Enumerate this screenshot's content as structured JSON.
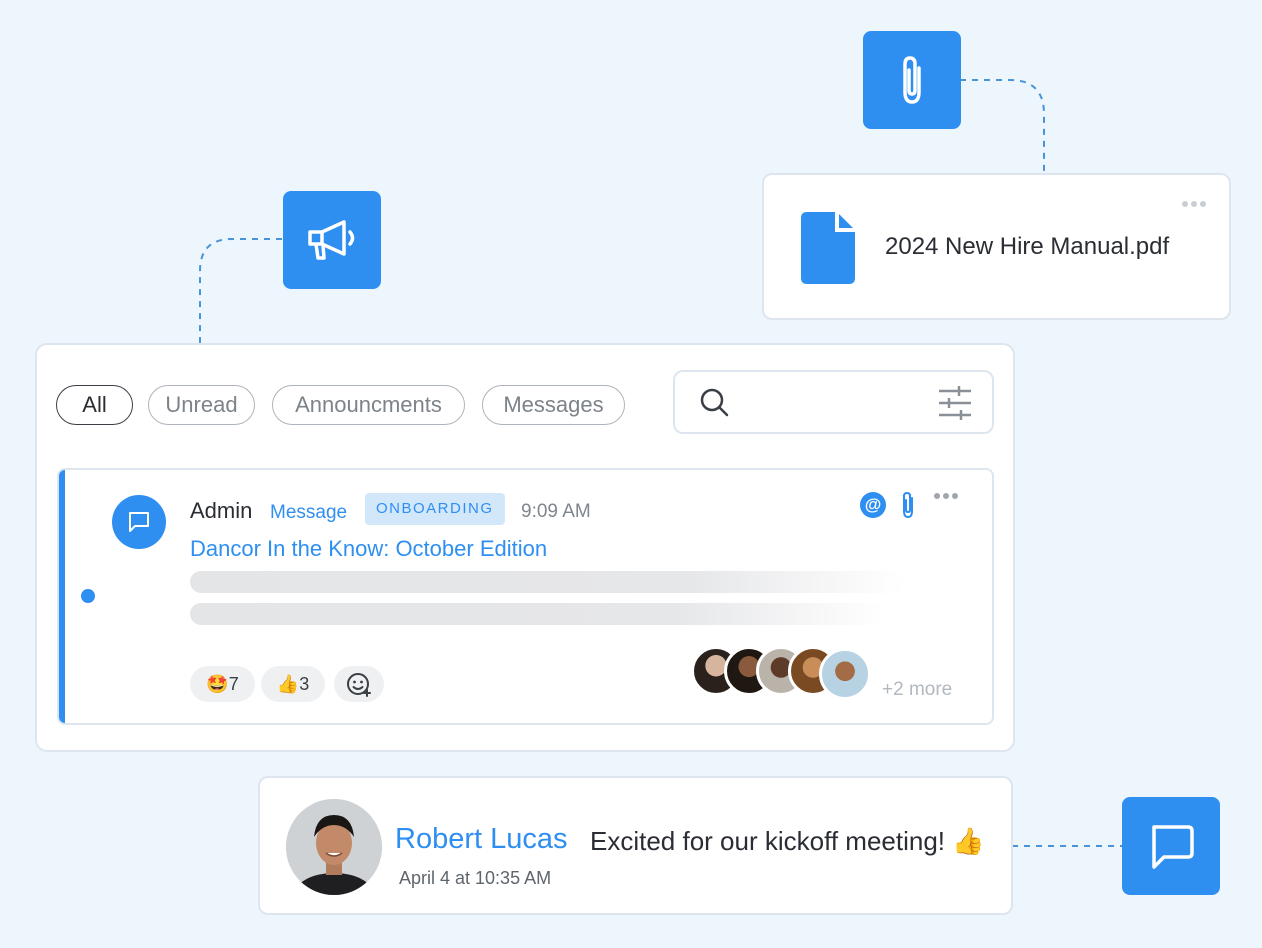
{
  "file_card": {
    "filename": "2024 New Hire Manual.pdf"
  },
  "feed": {
    "filters": [
      {
        "label": "All",
        "active": true
      },
      {
        "label": "Unread",
        "active": false
      },
      {
        "label": "Announcments",
        "active": false
      },
      {
        "label": "Messages",
        "active": false
      }
    ],
    "search": {
      "placeholder": ""
    },
    "post": {
      "author": "Admin",
      "type": "Message",
      "tag": "ONBOARDING",
      "time": "9:09 AM",
      "title": "Dancor In the Know: October Edition",
      "unread": true,
      "reactions": [
        {
          "emoji": "🤩",
          "count": "7"
        },
        {
          "emoji": "👍",
          "count": "3"
        }
      ],
      "more_viewers": "+2 more"
    }
  },
  "comment": {
    "name": "Robert Lucas",
    "text": "Excited for our kickoff meeting! 👍",
    "timestamp": "April 4 at 10:35 AM"
  },
  "colors": {
    "accent": "#2e8ff0",
    "background": "#edf5fd",
    "tag_bg": "#d3e7fb"
  }
}
